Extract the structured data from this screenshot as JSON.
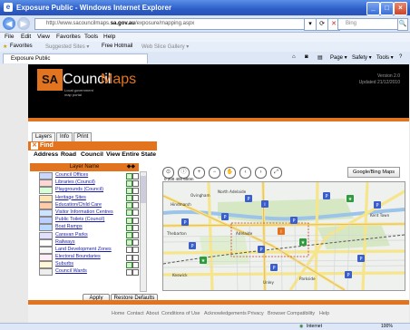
{
  "window": {
    "title": "Exposure Public - Windows Internet Explorer",
    "minimize": "_",
    "maximize": "□",
    "close": "×"
  },
  "address": {
    "url_prefix": "http://www.sacouncilmaps.",
    "url_domain": "sa.gov.au",
    "url_path": "/exposure/mapping.aspx",
    "search_placeholder": "Bing",
    "back": "◀",
    "forward": "▶",
    "refresh": "⟳",
    "stop": "✕",
    "search_go": "🔍",
    "dropdown": "▾"
  },
  "menu": [
    "File",
    "Edit",
    "View",
    "Favorites",
    "Tools",
    "Help"
  ],
  "favorites": {
    "label": "Favorites",
    "suggested": "Suggested Sites ▾",
    "hotmail": "Free Hotmail",
    "gallery": "Web Slice Gallery ▾"
  },
  "tab": {
    "title": "Exposure Public"
  },
  "commandbar": [
    "Page ▾",
    "Safety ▾",
    "Tools ▾"
  ],
  "header": {
    "logo_sa": "SA",
    "logo_council": "Council",
    "logo_maps": "Maps",
    "logo_sub": "Local government\nmap portal",
    "version_line1": "Version 2.0",
    "version_line2": "Updated 21/12/2010"
  },
  "panel": {
    "tabs": [
      "Layers",
      "Info",
      "Print"
    ],
    "find_title": "Find",
    "find_tabs": [
      "Address",
      "Road",
      "Council",
      "View Entire State"
    ],
    "layer_header": "Layer Name",
    "apply": "Apply",
    "restore": "Restore Defaults"
  },
  "layers": [
    {
      "name": "Council Offices",
      "swatch": "#c9d6ff",
      "c1": true,
      "c2": false
    },
    {
      "name": "Libraries (Council)",
      "swatch": "#ffd6d6",
      "c1": true,
      "c2": false
    },
    {
      "name": "Playgrounds (Council)",
      "swatch": "#d6ffd6",
      "c1": true,
      "c2": false
    },
    {
      "name": "Heritage Sites",
      "swatch": "#ffe4b3",
      "c1": true,
      "c2": false
    },
    {
      "name": "Education/Child Care",
      "swatch": "#ffccaa",
      "c1": true,
      "c2": false
    },
    {
      "name": "Visitor Information Centres",
      "swatch": "#cde3ff",
      "c1": true,
      "c2": false
    },
    {
      "name": "Public Toilets (Council)",
      "swatch": "#bcd0ff",
      "c1": true,
      "c2": false
    },
    {
      "name": "Boat Ramps",
      "swatch": "#b8d8ff",
      "c1": true,
      "c2": false
    },
    {
      "name": "Caravan Parks",
      "swatch": "#e0e0ff",
      "c1": true,
      "c2": false
    },
    {
      "name": "Railways",
      "swatch": "#ffffff",
      "c1": true,
      "c2": false
    },
    {
      "name": "Land Development Zones",
      "swatch": "#f7f7f7",
      "c1": false,
      "c2": false
    },
    {
      "name": "Electoral Boundaries",
      "swatch": "#ffeef7",
      "c1": false,
      "c2": false
    },
    {
      "name": "Suburbs",
      "swatch": "#fff7d6",
      "c1": true,
      "c2": false
    },
    {
      "name": "Council Wards",
      "swatch": "#eeeeee",
      "c1": false,
      "c2": false
    }
  ],
  "map": {
    "button": "Google/Bing Maps",
    "scale": "0   200  400  600m",
    "tools": [
      "⊙",
      "ⓘ",
      "+",
      "−",
      "✋",
      "‹",
      "›",
      "⤢"
    ],
    "labels": [
      {
        "text": "North Adelaide"
      },
      {
        "text": "Adelaide"
      },
      {
        "text": "Kent Town"
      },
      {
        "text": "Parkside"
      },
      {
        "text": "Unley"
      },
      {
        "text": "Keswick"
      },
      {
        "text": "Thebarton"
      },
      {
        "text": "Hindmarsh"
      },
      {
        "text": "Ovingham"
      }
    ]
  },
  "footer": {
    "links": [
      "Home",
      "Contact",
      "About",
      "Conditions of Use",
      "Acknowledgements",
      "Privacy",
      "Browser Compatibility",
      "Help"
    ]
  },
  "status": {
    "zone": "Internet",
    "zoom": "100%"
  },
  "colors": {
    "orange": "#e2741f",
    "link": "#1a1aa8",
    "ie_blue": "#2c5dc7"
  }
}
